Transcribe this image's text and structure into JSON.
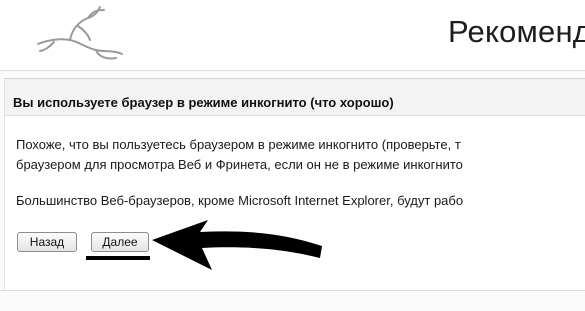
{
  "header": {
    "title": "Рекоменд",
    "logo_icon": "rabbit-logo-icon"
  },
  "panel": {
    "title": "Вы используете браузер в режиме инкогнито (что хорошо)",
    "paragraphs": [
      {
        "lines": [
          "Похоже, что вы пользуетесь браузером в режиме инкогнито (проверьте, т",
          "браузером для просмотра Веб и Фринета, если он не в режиме инкогнито"
        ]
      },
      {
        "lines": [
          "Большинство Веб-браузеров, кроме Microsoft Internet Explorer, будут рабо"
        ]
      }
    ]
  },
  "buttons": {
    "back_label": "Назад",
    "next_label": "Далее"
  },
  "annotation": {
    "arrow_icon": "pointer-arrow-icon",
    "color": "#000000"
  }
}
